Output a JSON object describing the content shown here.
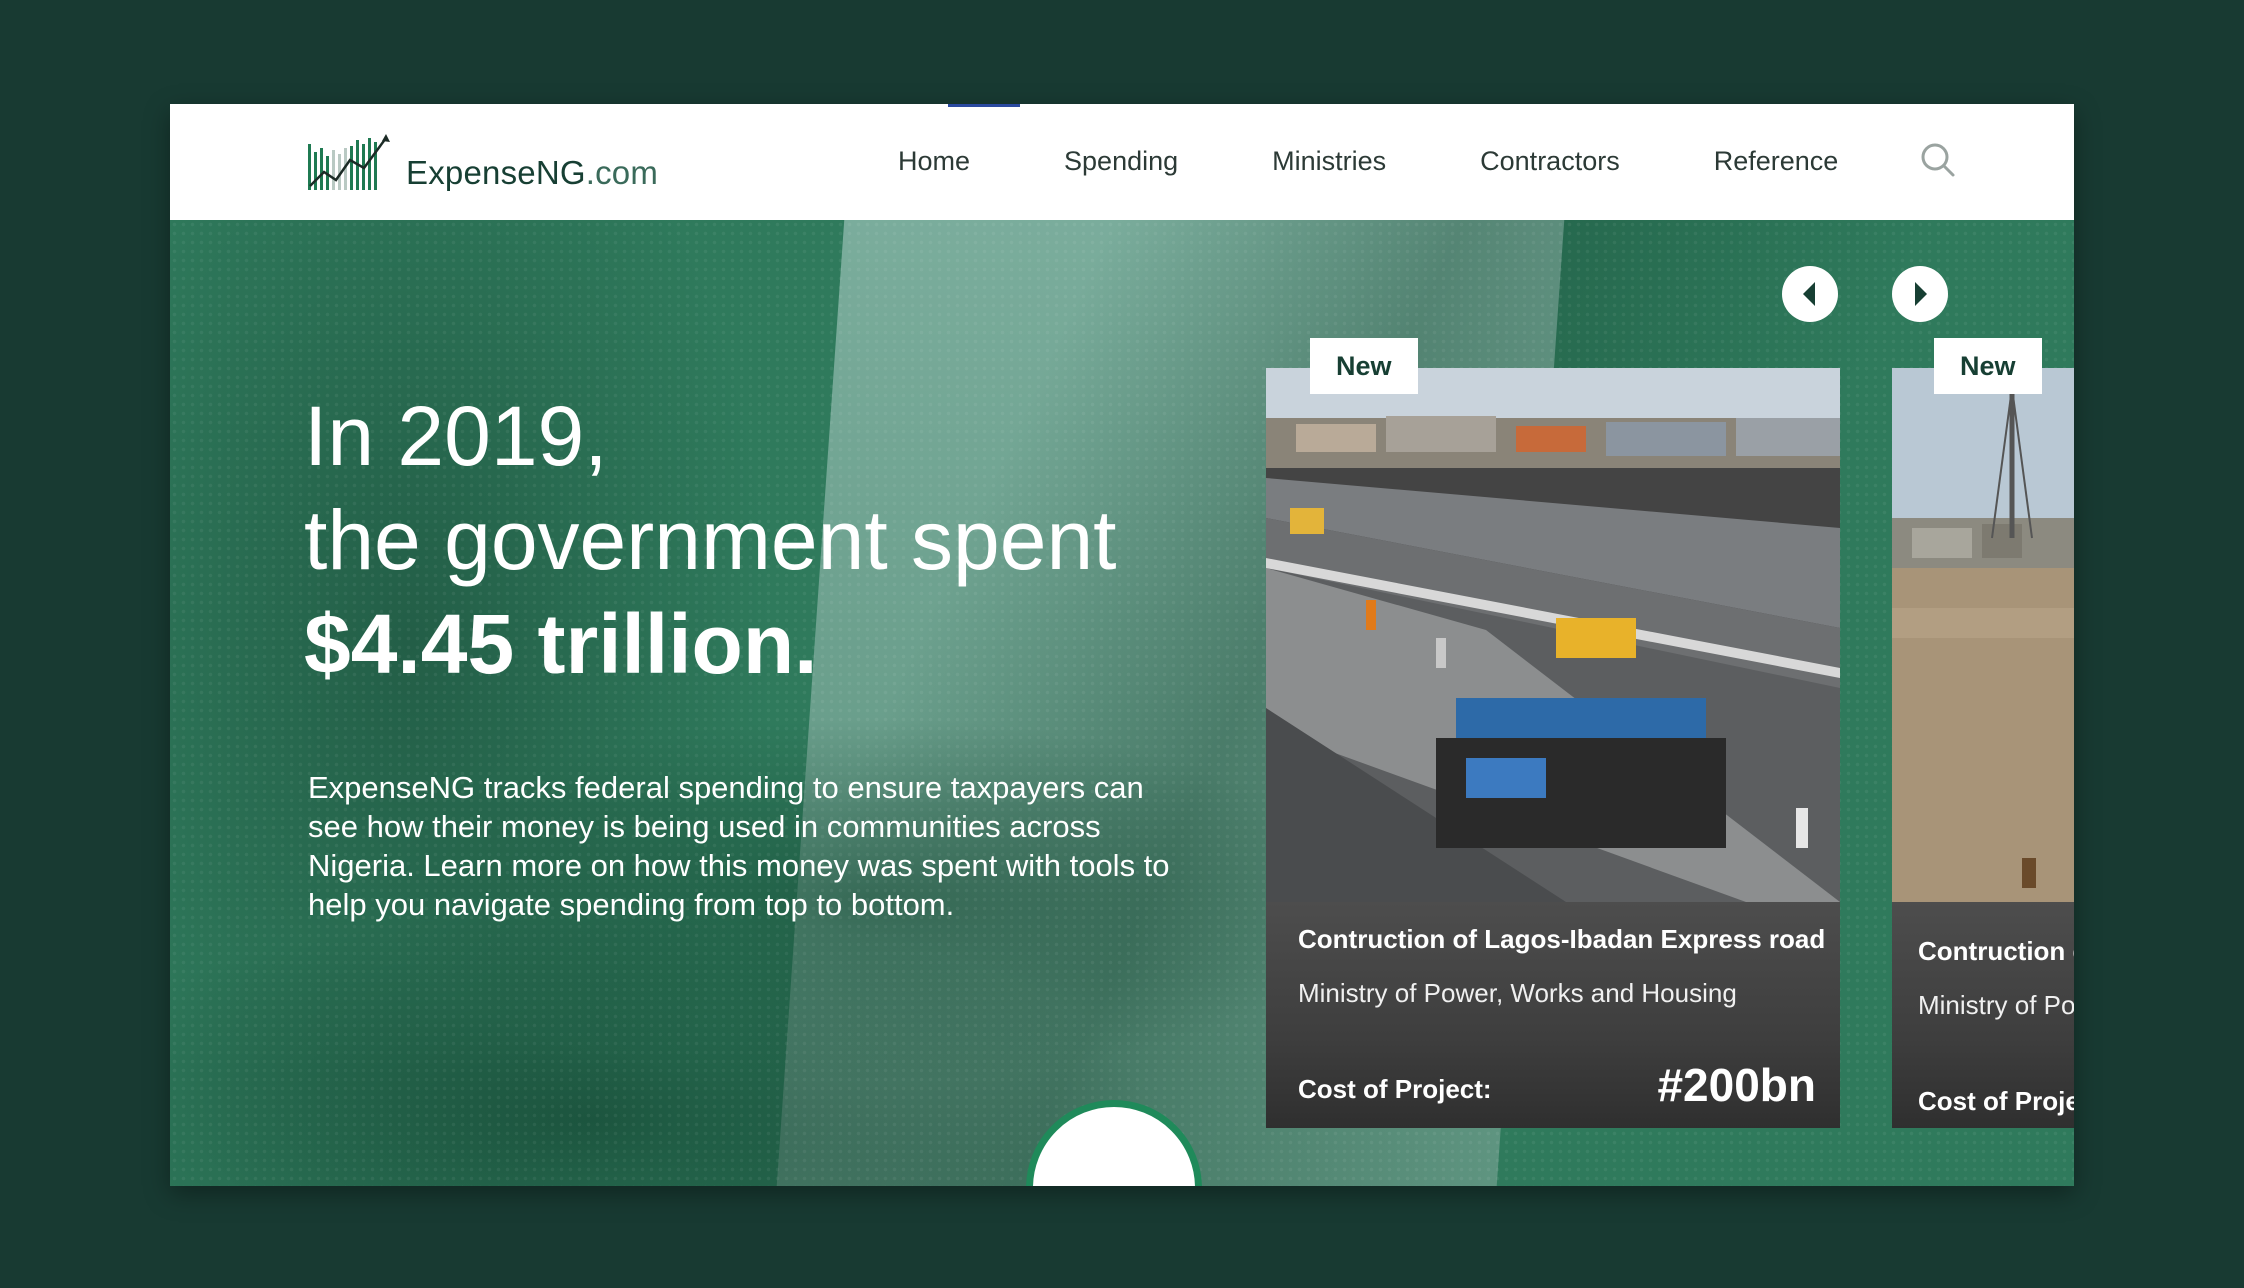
{
  "header": {
    "logo": {
      "name": "ExpenseNG",
      "domain": ".com",
      "icon": "bar-chart-growth-icon"
    },
    "nav": [
      "Home",
      "Spending",
      "Ministries",
      "Contractors",
      "Reference"
    ],
    "search_icon": "search-icon"
  },
  "hero": {
    "headline_line1": "In 2019,",
    "headline_line2": "the government spent",
    "headline_amount": "$4.45 trillion.",
    "intro": "ExpenseNG tracks federal spending to ensure taxpayers can see how their money is being used in communities across Nigeria. Learn more on how this money was spent with tools to help you navigate spending from top to bottom.",
    "prev_icon": "chevron-left-icon",
    "next_icon": "chevron-right-icon"
  },
  "cards": [
    {
      "badge": "New",
      "title": "Contruction of Lagos-Ibadan Express road",
      "ministry": "Ministry of Power, Works and Housing",
      "cost_label": "Cost of Project:",
      "cost_value": "#200bn"
    },
    {
      "badge": "New",
      "title": "Contruction c",
      "ministry": "Ministry of Po",
      "cost_label": "Cost of Projec"
    }
  ],
  "colors": {
    "page_bg": "#183a32",
    "hero_green": "#2f7a5c",
    "brand_dark": "#173f33",
    "accent_blue": "#2b4aa0"
  }
}
